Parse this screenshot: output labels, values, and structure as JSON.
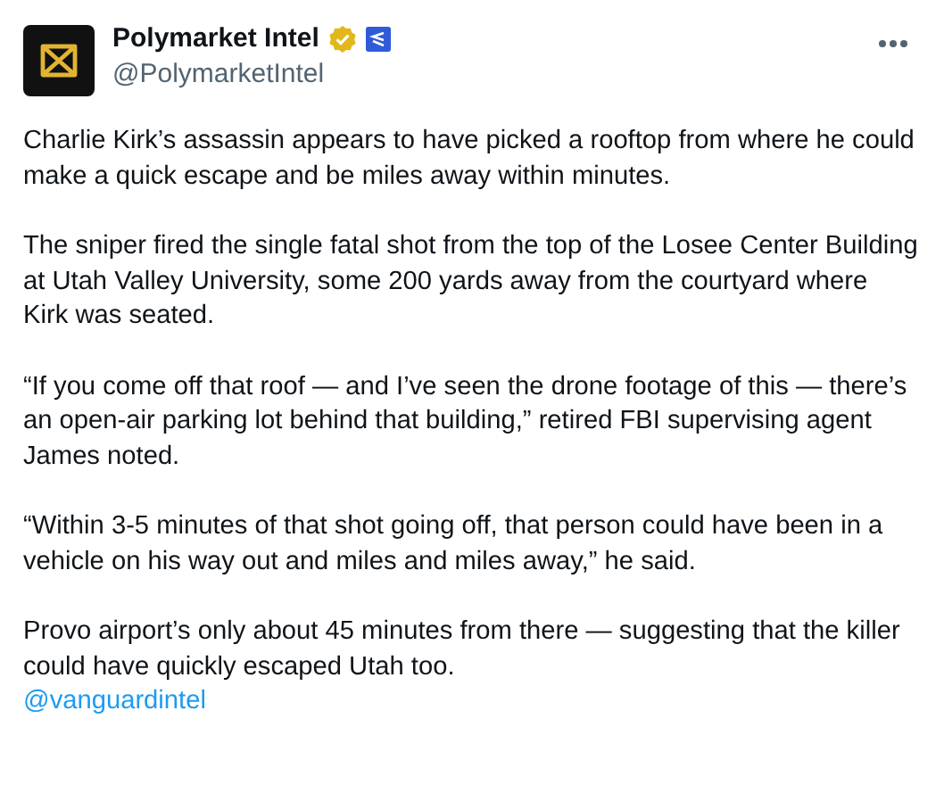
{
  "author": {
    "name": "Polymarket Intel",
    "handle": "@PolymarketIntel",
    "verified": true,
    "affiliate_badge": true
  },
  "paragraphs": [
    "Charlie Kirk’s assassin appears to have picked a rooftop from where he could make a quick escape and be miles away within minutes.",
    "The sniper fired the single fatal shot from the top of the Losee Center Building at Utah Valley University, some 200 yards away from the courtyard where Kirk was seated.",
    "“If you come off that roof — and I’ve seen the drone footage of this — there’s an open-air parking lot behind that building,” retired FBI supervising agent James noted.",
    "“Within 3-5 minutes of that shot going off, that person could have been in a vehicle on his way out and miles and miles away,” he said.",
    "Provo airport’s only about 45 minutes from there — suggesting that the killer could have quickly escaped Utah too."
  ],
  "mention": "@vanguardintel"
}
